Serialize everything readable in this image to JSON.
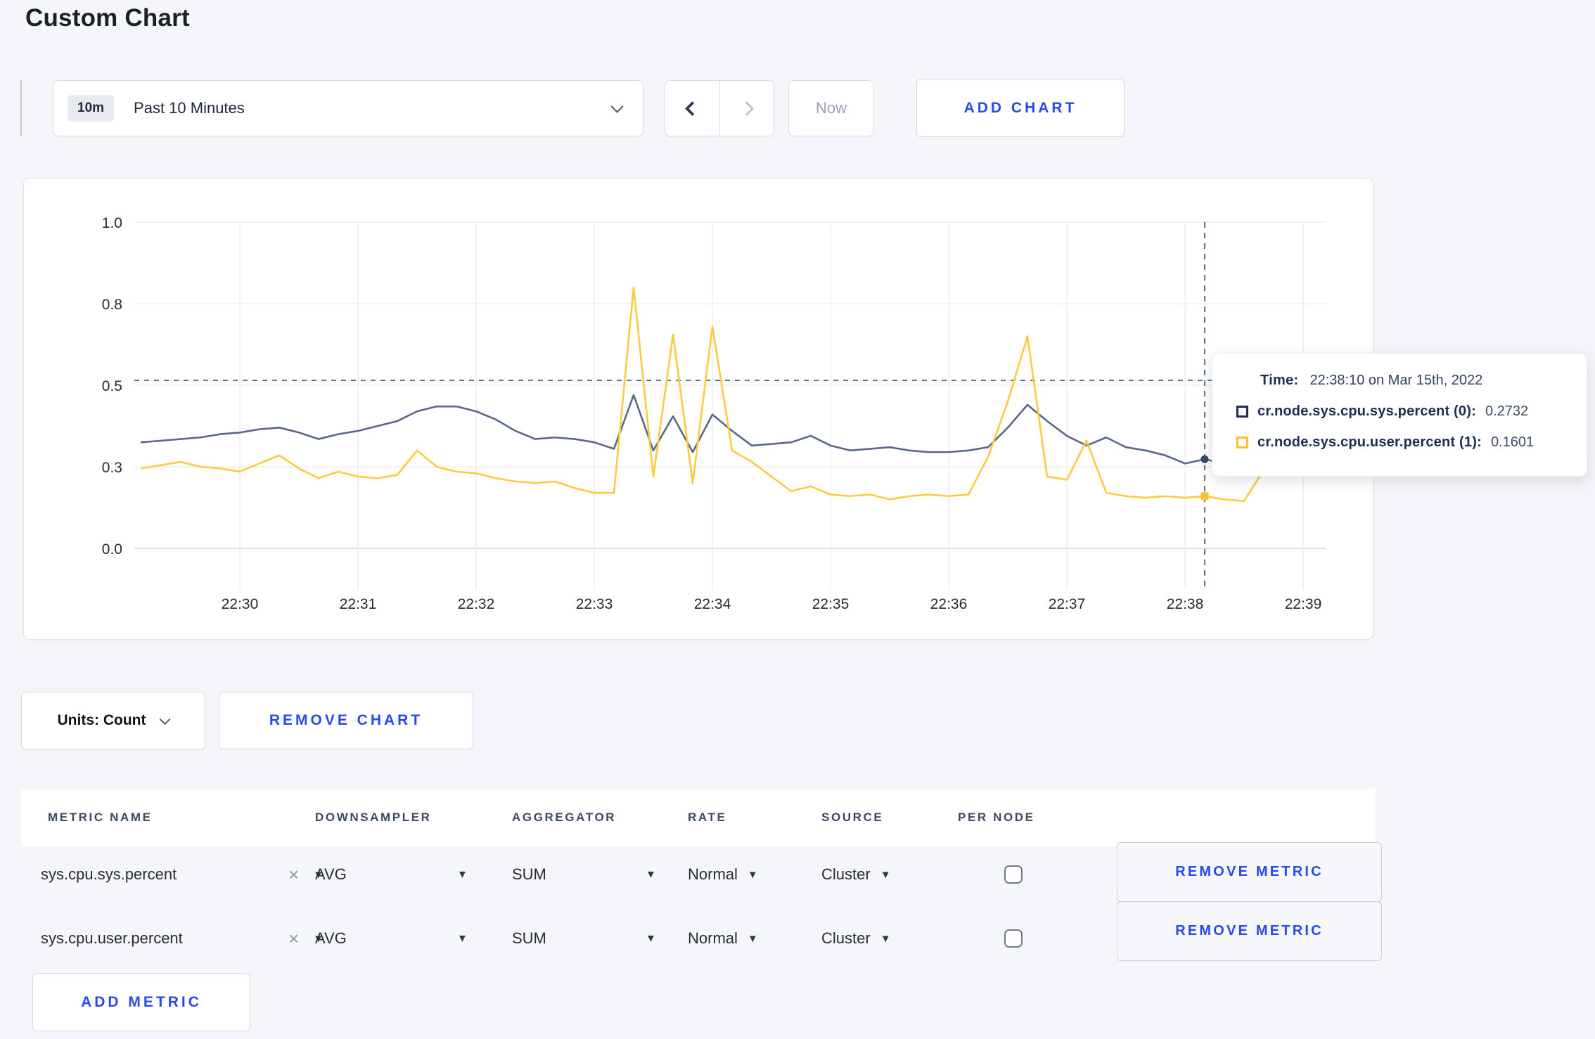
{
  "page_title": "Custom Chart",
  "colors": {
    "accent": "#2749f0",
    "series_sys": "#59688a",
    "series_user": "#fecb3f",
    "tooltip_swatch_sys": "#1d2d52",
    "tooltip_swatch_user": "#fdc02e",
    "crosshair": "#607690"
  },
  "toolbar": {
    "time_badge": "10m",
    "time_label": "Past 10 Minutes",
    "now_label": "Now",
    "add_chart_label": "ADD CHART"
  },
  "chart_data": {
    "type": "line",
    "x_start_time": "22:29:10",
    "x_step_seconds": 10,
    "x_axis_ticks": [
      "22:30",
      "22:31",
      "22:32",
      "22:33",
      "22:34",
      "22:35",
      "22:36",
      "22:37",
      "22:38",
      "22:39"
    ],
    "y_axis_tick_labels": [
      "0.0",
      "0.3",
      "0.5",
      "0.8",
      "1.0"
    ],
    "y_axis_tick_values": [
      0,
      0.25,
      0.5,
      0.75,
      1.0
    ],
    "ylim": [
      0,
      1
    ],
    "grid": true,
    "series": [
      {
        "name": "cr.node.sys.cpu.sys.percent",
        "color": "#59688a",
        "values": [
          0.325,
          0.33,
          0.335,
          0.34,
          0.35,
          0.355,
          0.365,
          0.37,
          0.355,
          0.335,
          0.35,
          0.36,
          0.375,
          0.39,
          0.42,
          0.435,
          0.435,
          0.42,
          0.395,
          0.36,
          0.335,
          0.34,
          0.335,
          0.325,
          0.305,
          0.47,
          0.3,
          0.405,
          0.295,
          0.41,
          0.36,
          0.315,
          0.32,
          0.325,
          0.345,
          0.315,
          0.3,
          0.305,
          0.31,
          0.3,
          0.295,
          0.295,
          0.3,
          0.31,
          0.37,
          0.44,
          0.39,
          0.345,
          0.315,
          0.34,
          0.31,
          0.3,
          0.285,
          0.26,
          0.2732,
          0.26,
          0.27,
          0.285,
          0.295,
          0.29
        ]
      },
      {
        "name": "cr.node.sys.cpu.user.percent",
        "color": "#fecb3f",
        "values": [
          0.245,
          0.255,
          0.265,
          0.25,
          0.245,
          0.235,
          0.26,
          0.285,
          0.245,
          0.215,
          0.235,
          0.22,
          0.215,
          0.225,
          0.3,
          0.25,
          0.235,
          0.23,
          0.215,
          0.205,
          0.2,
          0.205,
          0.185,
          0.17,
          0.17,
          0.8,
          0.22,
          0.655,
          0.2,
          0.68,
          0.3,
          0.265,
          0.22,
          0.175,
          0.19,
          0.165,
          0.16,
          0.165,
          0.15,
          0.16,
          0.165,
          0.16,
          0.165,
          0.28,
          0.45,
          0.65,
          0.22,
          0.21,
          0.33,
          0.17,
          0.16,
          0.155,
          0.16,
          0.155,
          0.1601,
          0.15,
          0.145,
          0.24,
          0.31,
          0.27
        ]
      }
    ],
    "crosshair": {
      "time": "22:38:10",
      "minutes_after_22_30": 8.1667,
      "h_line_value": 0.515,
      "hover_values": [
        0.2732,
        0.1601
      ]
    }
  },
  "tooltip": {
    "time_label": "Time:",
    "time_value": "22:38:10 on Mar 15th, 2022",
    "entries": [
      {
        "name": "cr.node.sys.cpu.sys.percent (0):",
        "value": "0.2732",
        "swatch_color": "#1d2d52"
      },
      {
        "name": "cr.node.sys.cpu.user.percent (1):",
        "value": "0.1601",
        "swatch_color": "#fdc02e"
      }
    ]
  },
  "chart_controls": {
    "units_label": "Units: Count",
    "remove_chart_label": "REMOVE CHART"
  },
  "metrics_table": {
    "headers": [
      "METRIC NAME",
      "DOWNSAMPLER",
      "AGGREGATOR",
      "RATE",
      "SOURCE",
      "PER NODE"
    ],
    "rows": [
      {
        "metric_name": "sys.cpu.sys.percent",
        "downsampler": "AVG",
        "aggregator": "SUM",
        "rate": "Normal",
        "source": "Cluster",
        "per_node_checked": false,
        "remove_label": "REMOVE METRIC"
      },
      {
        "metric_name": "sys.cpu.user.percent",
        "downsampler": "AVG",
        "aggregator": "SUM",
        "rate": "Normal",
        "source": "Cluster",
        "per_node_checked": false,
        "remove_label": "REMOVE METRIC"
      }
    ],
    "add_metric_label": "ADD METRIC"
  }
}
